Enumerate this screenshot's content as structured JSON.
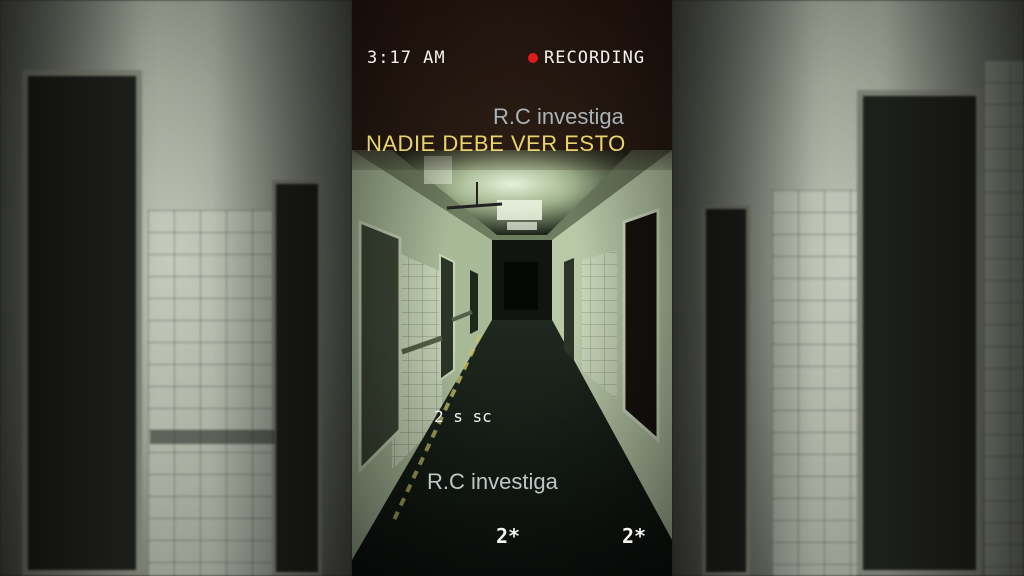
{
  "overlay": {
    "time": "3:17 AM",
    "recording_label": "RECORDING",
    "brand_top": "R.C investiga",
    "headline": "NADIE DEBE VER ESTO",
    "mid_text": "2 s sc",
    "brand_bottom": "R.C investiga",
    "counter_left": "2*",
    "counter_right": "2*"
  },
  "colors": {
    "recording_dot": "#e01b1b",
    "headline": "#e9d46c",
    "brand": "#a9b3b8",
    "corridor_light": "#d8e8c8"
  }
}
